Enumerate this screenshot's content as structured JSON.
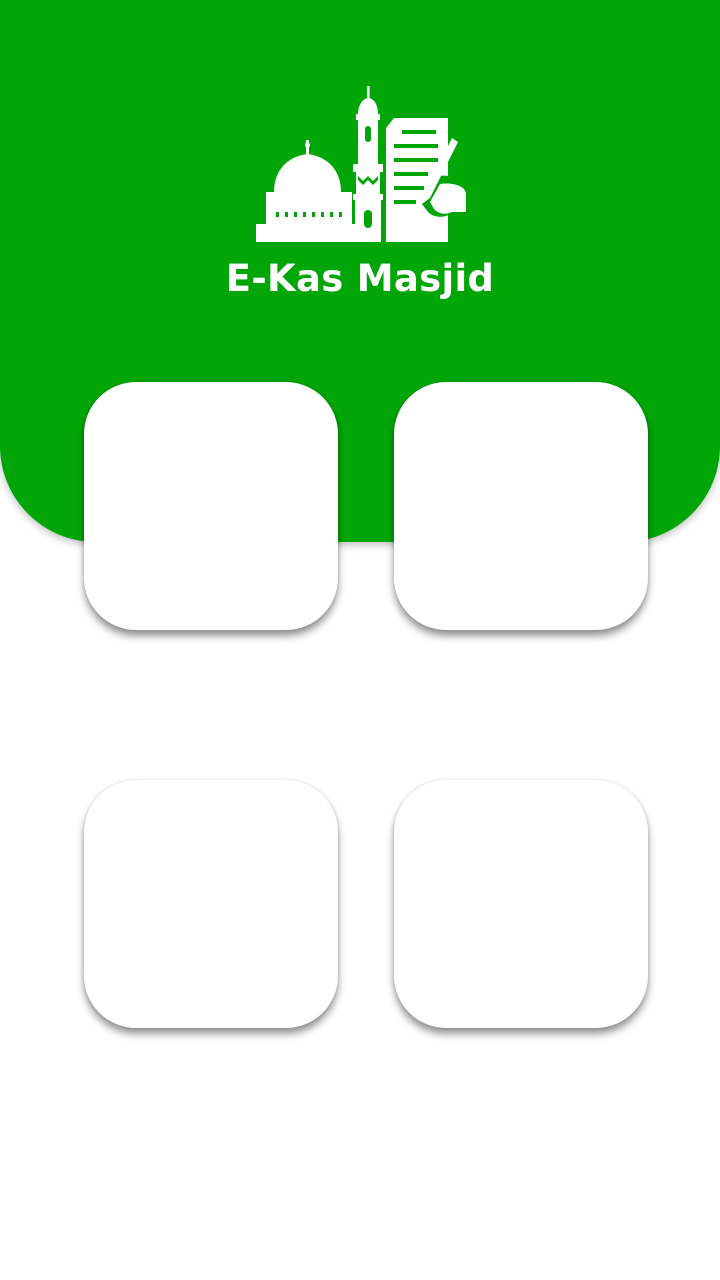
{
  "app": {
    "title": "E-Kas Masjid",
    "logo_icon": "mosque-ledger-icon"
  },
  "colors": {
    "primary": "#00a608",
    "background": "#ffffff",
    "card": "#ffffff"
  },
  "menu": {
    "cards": [
      {
        "id": "card-1"
      },
      {
        "id": "card-2"
      },
      {
        "id": "card-3"
      },
      {
        "id": "card-4"
      }
    ]
  }
}
